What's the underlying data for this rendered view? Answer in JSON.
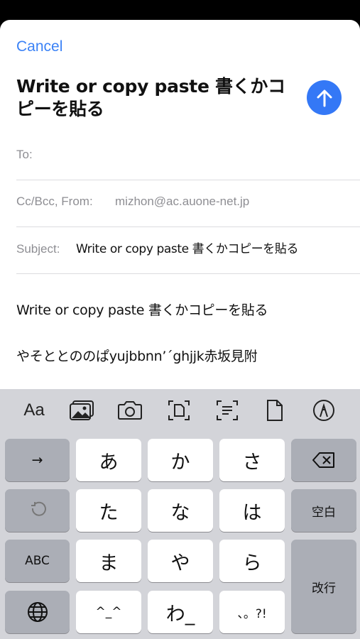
{
  "compose": {
    "cancel_label": "Cancel",
    "title": "Write or copy paste  書くかコピーを貼る",
    "to_label": "To:",
    "cc_label": "Cc/Bcc, From:",
    "from_value": "mizhon@ac.auone-net.jp",
    "subject_label": "Subject:",
    "subject_value": "Write or copy paste  書くかコピーを貼る",
    "body_line1": "Write or copy paste 書くかコピーを貼る",
    "body_line2": "やそととののぱyujbbnn’´ghjjk赤坂見附",
    "accent_color": "#3478f6"
  },
  "keyboard": {
    "toolbar": {
      "format_label": "Aa",
      "icons": [
        "photo-library-icon",
        "camera-icon",
        "scan-document-icon",
        "scan-text-icon",
        "document-icon",
        "markup-icon"
      ]
    },
    "keys": {
      "arrow": "→",
      "a": "あ",
      "ka": "か",
      "sa": "さ",
      "ta": "た",
      "na": "な",
      "ha": "は",
      "space": "空白",
      "abc": "ABC",
      "ma": "ま",
      "ya": "や",
      "ra": "ら",
      "return": "改行",
      "kaomoji": "^_^",
      "wa": "わ_",
      "punct": "、。?!"
    }
  }
}
